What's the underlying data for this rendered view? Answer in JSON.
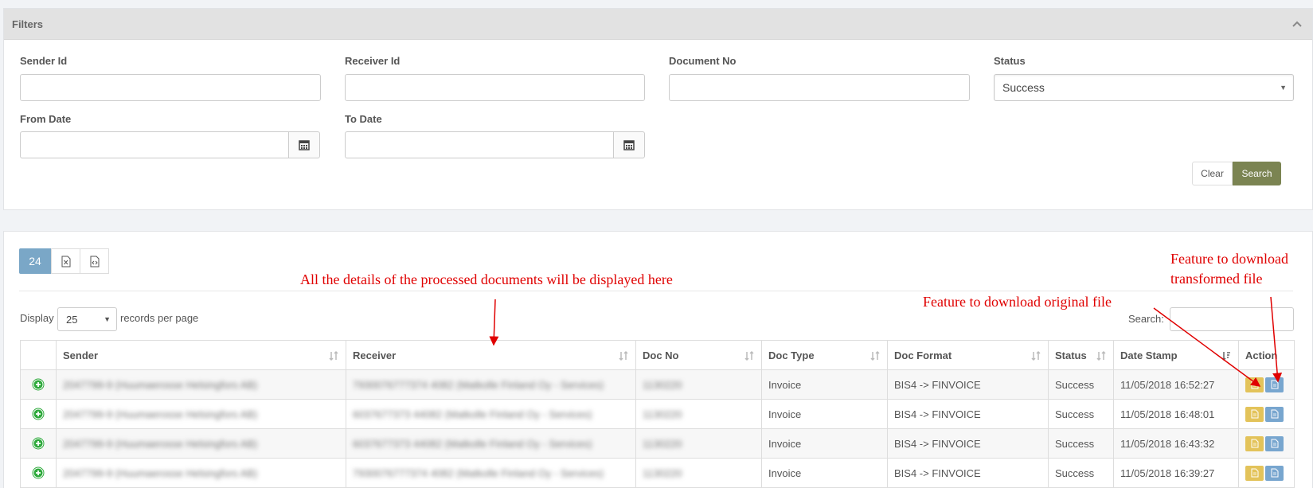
{
  "filters": {
    "title": "Filters",
    "sender_id_label": "Sender Id",
    "receiver_id_label": "Receiver Id",
    "document_no_label": "Document No",
    "status_label": "Status",
    "status_value": "Success",
    "from_date_label": "From Date",
    "to_date_label": "To Date",
    "clear_label": "Clear",
    "search_label": "Search"
  },
  "results": {
    "count": "24",
    "display_label": "Display",
    "page_size": "25",
    "records_label": "records per page",
    "search_label": "Search:",
    "columns": [
      "Sender",
      "Receiver",
      "Doc No",
      "Doc Type",
      "Doc Format",
      "Status",
      "Date Stamp",
      "Action"
    ],
    "rows": [
      {
        "sender": "2047799-9 (Huumaerosse Helsingfors AB)",
        "receiver": "7930076777374 4082 (Matkolle Finland Oy - Services)",
        "doc_no": "1130220",
        "doc_type": "Invoice",
        "doc_format": "BIS4 -> FINVOICE",
        "status": "Success",
        "date": "11/05/2018 16:52:27"
      },
      {
        "sender": "2047799-9 (Huumaerosse Helsingfors AB)",
        "receiver": "6037677373 44082 (Matkolle Finland Oy - Services)",
        "doc_no": "1130220",
        "doc_type": "Invoice",
        "doc_format": "BIS4 -> FINVOICE",
        "status": "Success",
        "date": "11/05/2018 16:48:01"
      },
      {
        "sender": "2047799-9 (Huumaerosse Helsingfors AB)",
        "receiver": "6037677373 44082 (Matkolle Finland Oy - Services)",
        "doc_no": "1130220",
        "doc_type": "Invoice",
        "doc_format": "BIS4 -> FINVOICE",
        "status": "Success",
        "date": "11/05/2018 16:43:32"
      },
      {
        "sender": "2047799-9 (Huumaerosse Helsingfors AB)",
        "receiver": "7930076777374 4082 (Matkolle Finland Oy - Services)",
        "doc_no": "1130220",
        "doc_type": "Invoice",
        "doc_format": "BIS4 -> FINVOICE",
        "status": "Success",
        "date": "11/05/2018 16:39:27"
      }
    ]
  },
  "annotations": {
    "details": "All the details of the processed documents will be displayed here",
    "original_file": "Feature to download original file",
    "transformed_line1": "Feature to download",
    "transformed_line2": "transformed file"
  },
  "colors": {
    "search_button": "#7b8452",
    "count_badge": "#7aa7c7",
    "download_original": "#e3c35a",
    "download_transformed": "#78a6cf",
    "annotation": "#e00000",
    "add_icon": "#2eaa3c"
  }
}
